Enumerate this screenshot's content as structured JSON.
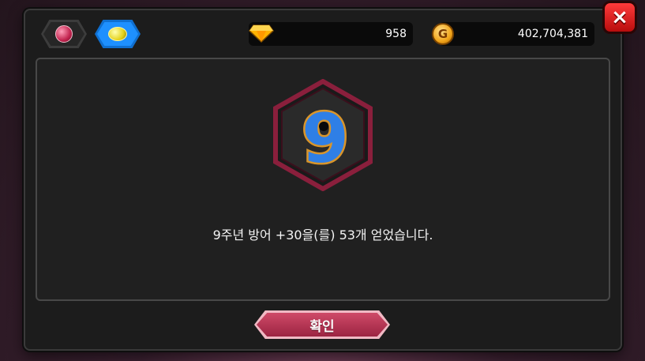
{
  "tabs": [
    {
      "icon": "ruby-icon",
      "active": false
    },
    {
      "icon": "potion-icon",
      "active": true
    }
  ],
  "currency": {
    "gems": "958",
    "gold": "402,704,381",
    "gold_symbol": "G"
  },
  "close_icon": "×",
  "reward": {
    "badge_icon": "anniversary-9-icon",
    "message": "9주년 방어 +30을(를) 53개 얻었습니다."
  },
  "confirm_label": "확인",
  "colors": {
    "accent": "#c9405f",
    "tab_active": "#1e90ff",
    "badge_border": "#8a1f3c"
  }
}
